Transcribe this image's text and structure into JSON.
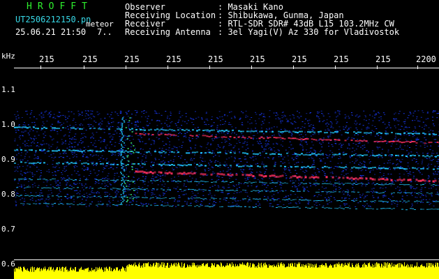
{
  "header": {
    "logo": "HROFFT",
    "filename": "UT2506212150.pn",
    "meteor_label": "meteor",
    "datetime": "25.06.21 21:50",
    "count": "7..",
    "observer_label": "Observer",
    "observer_value": ": Masaki Kano",
    "location_label": "Receiving Location",
    "location_value": ": Shibukawa, Gunma, Japan",
    "receiver_label": "Receiver",
    "receiver_value": ": RTL-SDR SDR# 43dB L15 103.2MHz CW",
    "antenna_label": "Receiving Antenna",
    "antenna_value": ": 3el Yagi(V) Az 330 for Vladivostok"
  },
  "axes": {
    "y_unit": "kHz",
    "y_ticks": [
      "1.1",
      "1.0",
      "0.9",
      "0.8",
      "0.7",
      "0.6"
    ],
    "x_ticks": [
      "215",
      "215",
      "215",
      "215",
      "215",
      "215",
      "215",
      "215",
      "215",
      "2200"
    ]
  },
  "colors": {
    "background": "#000000",
    "noise": "#1a3cff",
    "mid": "#20c8ff",
    "strong": "#ff3060",
    "spectrum": "#ffff00",
    "logo": "#2ef02e",
    "label": "#38d9e8"
  }
}
